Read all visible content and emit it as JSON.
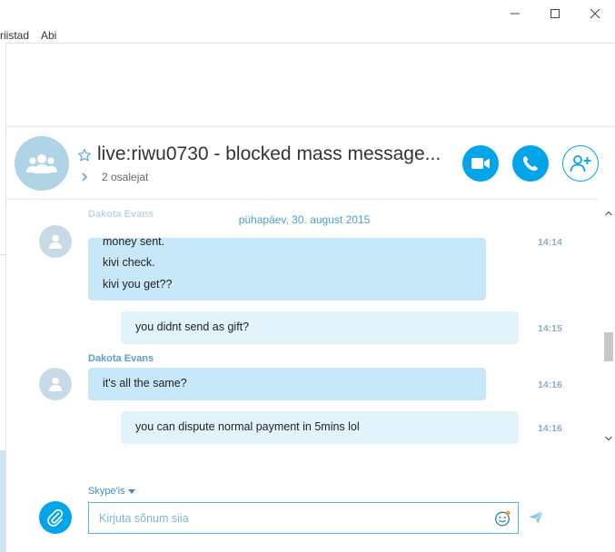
{
  "menu": {
    "tools_label": "riistad",
    "help_label": "Abi"
  },
  "conversation": {
    "title": "live:riwu0730 - blocked mass message...",
    "participants": "2 osalejat"
  },
  "messages": {
    "date_header": "pühapäev, 30. august 2015",
    "ghost_sender": "Dakota Evans",
    "group1": {
      "lines": [
        "money sent.",
        "kivi check.",
        "kivi you get??"
      ],
      "time": "14:14"
    },
    "out1": {
      "text": "you didnt send as gift?",
      "time": "14:15"
    },
    "group2": {
      "sender": "Dakota Evans",
      "text": "it's all the same?",
      "time": "14:16"
    },
    "out2": {
      "text": "you can dispute normal payment in 5mins lol",
      "time": "14:16"
    }
  },
  "composer": {
    "mode_label": "Skype'is",
    "placeholder": "Kirjuta sõnum siia"
  },
  "colors": {
    "accent": "#00a4e9",
    "incoming_bubble": "#c7e8f8",
    "outgoing_bubble": "#e3f3fb",
    "avatar": "#aed4e6"
  },
  "icons": {
    "minimize": "minimize-icon",
    "maximize": "maximize-icon",
    "close": "close-icon",
    "group_avatar": "group-icon",
    "favorite": "star-icon",
    "expand": "chevron-right-icon",
    "video_call": "video-camera-icon",
    "audio_call": "phone-icon",
    "add_people": "add-person-icon",
    "user_avatar": "person-icon",
    "attach": "paperclip-icon",
    "emoji": "emoji-icon",
    "send": "send-icon"
  }
}
